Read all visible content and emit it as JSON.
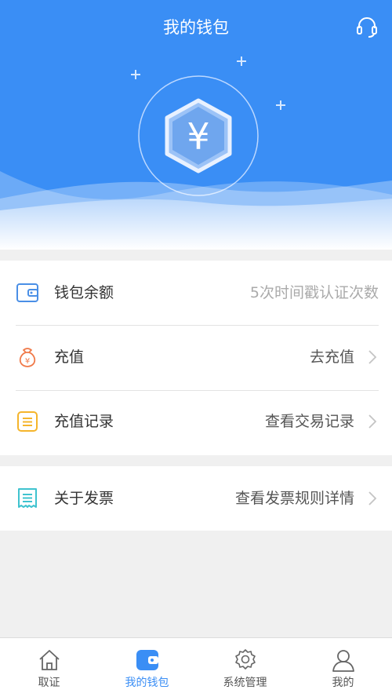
{
  "header": {
    "title": "我的钱包",
    "support_icon": "headset-icon",
    "hero_icon": "yen-badge-icon",
    "currency_symbol": "¥"
  },
  "wallet": {
    "rows": [
      {
        "label": "钱包余额",
        "value": "5次时间戳认证次数",
        "icon": "wallet-icon",
        "icon_color": "#4a8fe6",
        "has_chevron": false
      },
      {
        "label": "充值",
        "value": "去充值",
        "icon": "money-bag-icon",
        "icon_color": "#f07a4a",
        "has_chevron": true
      },
      {
        "label": "充值记录",
        "value": "查看交易记录",
        "icon": "document-list-icon",
        "icon_color": "#f5b52c",
        "has_chevron": true
      }
    ]
  },
  "invoice": {
    "label": "关于发票",
    "value": "查看发票规则详情",
    "icon": "receipt-icon",
    "icon_color": "#3fc3cf",
    "has_chevron": true
  },
  "tabbar": {
    "active_color": "#3a8ef5",
    "tabs": [
      {
        "label": "取证",
        "icon": "home-icon",
        "active": false
      },
      {
        "label": "我的钱包",
        "icon": "wallet-icon",
        "active": true
      },
      {
        "label": "系统管理",
        "icon": "gear-icon",
        "active": false
      },
      {
        "label": "我的",
        "icon": "user-icon",
        "active": false
      }
    ]
  },
  "colors": {
    "brand_blue": "#3a8ef5",
    "background": "#f0f0f0"
  }
}
